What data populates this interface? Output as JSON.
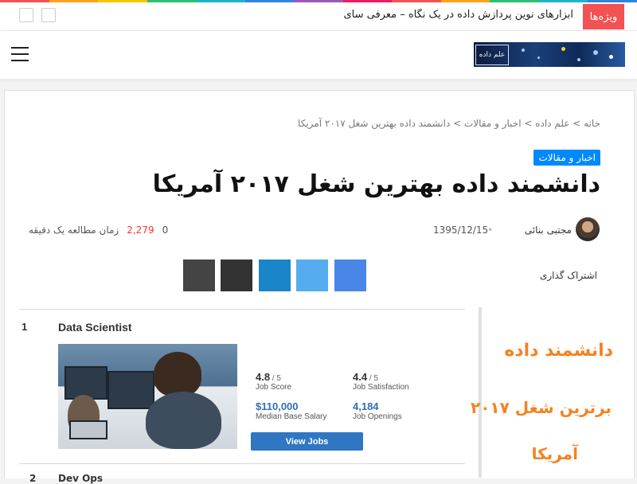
{
  "colors": {
    "rainbow": [
      "#f25254",
      "#f8a51e",
      "#f7c500",
      "#2fbf71",
      "#1fb5c4",
      "#2f84e0",
      "#9b59b6",
      "#e91e63",
      "#f25254",
      "#f8a51e",
      "#2fbf71",
      "#1fb5c4",
      "#2f84e0"
    ],
    "breaking": "#f25254",
    "category": "#0088ff",
    "share": [
      "#4a86e8",
      "#55acee",
      "#1a85c8",
      "#333333",
      "#444444"
    ],
    "accent_orange": "#f58220"
  },
  "topbar": {
    "breaking_label": "ویژه‌ها",
    "breaking_text": "ابزارهای نوین پردازش داده در یک نگاه – معرفی سای",
    "prev_icon": "",
    "next_icon": ""
  },
  "header": {
    "menu_icon": "menu-icon",
    "search_glyph": "",
    "logo_text": "علم داده"
  },
  "breadcrumb": "  خانه  >  علم داده  >  اخبار و مقالات  >  دانشمند داده بهترین شغل ۲۰۱۷ آمریکا",
  "article": {
    "category": "اخبار و مقالات",
    "title": "دانشمند داده بهترین شغل ۲۰۱۷ آمریکا",
    "author": "مجتبی بنائی  ",
    "date": "1395/12/15 ",
    "date_icon": "",
    "comments": " 0",
    "views": " 2,279",
    "read_time": " زمان مطالعه یک دقیقه"
  },
  "share": {
    "label": "اشتراک گذاری ",
    "buttons": [
      "",
      "",
      "",
      "",
      ""
    ]
  },
  "feature": {
    "rank": "1",
    "job_title": "Data Scientist",
    "job_score": "4.8",
    "job_score_of": " / 5",
    "job_score_label": "Job Score",
    "job_satisfaction": "4.4",
    "job_satisfaction_of": " / 5",
    "job_satisfaction_label": "Job Satisfaction",
    "salary": "$110,000",
    "salary_label": "Median Base Salary",
    "openings": "4,184",
    "openings_label": "Job Openings",
    "button": "View Jobs",
    "next_rank": "2",
    "next_title": "Dev Ops"
  },
  "side_caption": {
    "line1": "دانشمند داده",
    "line2": "برترین شغل ۲۰۱۷",
    "line3": "آمریکا"
  }
}
